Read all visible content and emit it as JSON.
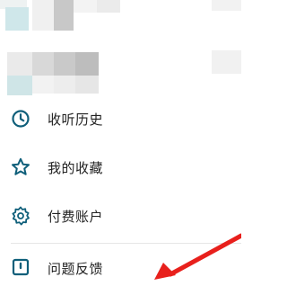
{
  "header": {
    "avatar_icon": "blurred-avatar-icon"
  },
  "menu": {
    "items": [
      {
        "icon": "clock-icon",
        "label": "收听历史"
      },
      {
        "icon": "star-icon",
        "label": "我的收藏"
      },
      {
        "icon": "gear-icon",
        "label": "付费账户"
      },
      {
        "icon": "feedback-icon",
        "label": "问题反馈"
      }
    ]
  },
  "colors": {
    "accent": "#0f5f7a",
    "arrow": "#e8201c",
    "text": "#222222",
    "divider": "#e6e6e6"
  }
}
